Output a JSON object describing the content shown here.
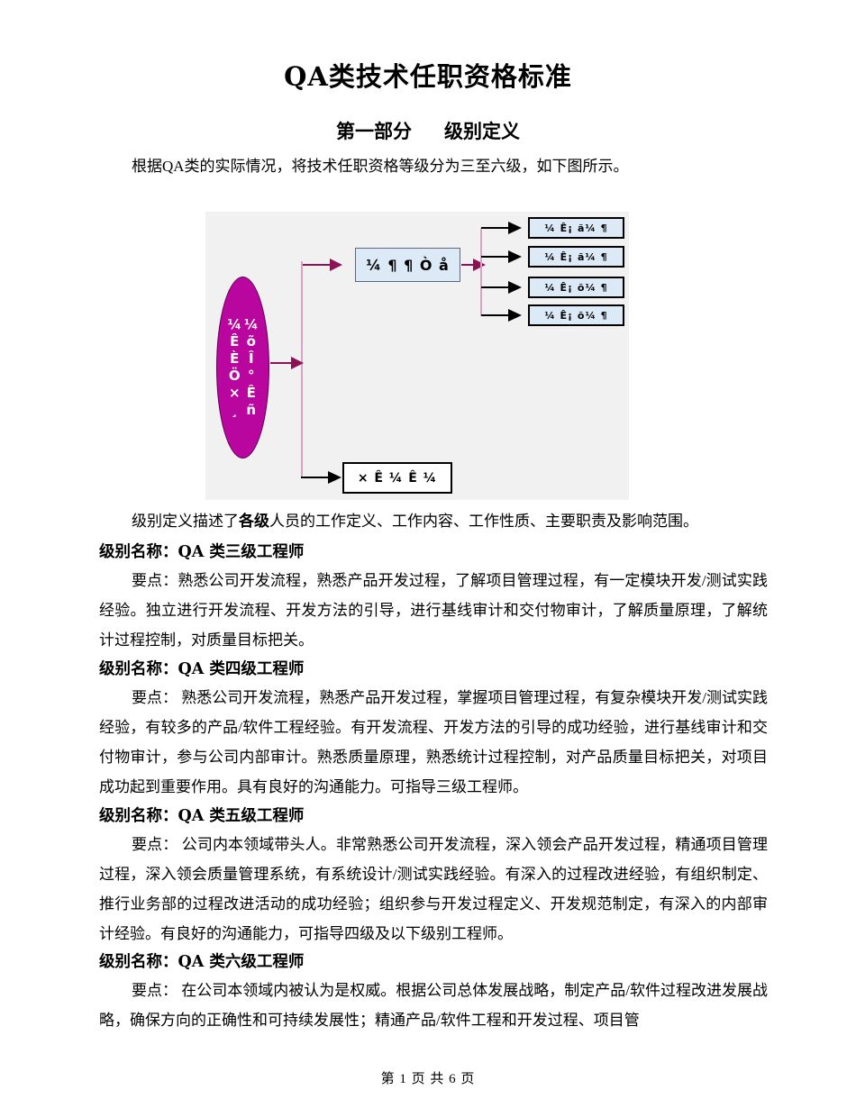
{
  "document": {
    "title": "QA类技术任职资格标准",
    "section_heading_left": "第一部分",
    "section_heading_right": "级别定义",
    "intro": "根据QA类的实际情况，将技术任职资格等级分为三至六级，如下图所示。"
  },
  "figure": {
    "ellipse_col_left": [
      "¼",
      "Ê",
      "È",
      "Ö",
      "×",
      "¸"
    ],
    "ellipse_col_right": [
      "¼",
      "õ",
      "Î",
      "°",
      "Ê",
      "ñ"
    ],
    "center_node": "¼ ¶ ¶ Ò å",
    "bottom_node": "× Ê ¼ Ê ¼",
    "leaf_nodes": [
      "¼ Ê¡ ã¼ ¶",
      "¼ Ê¡ ã¼ ¶",
      "¼ Ê¡ õ¼ ¶",
      "¼ Ê¡ õ¼ ¶"
    ],
    "colors": {
      "background": "#f1f1f1",
      "ellipse_fill": "#b8069e",
      "box_fill": "#dce9f7",
      "connector_pink": "#dca2c4",
      "arrow_pink": "#8c1155",
      "arrow_black": "#000000"
    }
  },
  "body": {
    "summary_line_prefix": "级别定义描述了",
    "summary_line_bold": "各级",
    "summary_line_suffix": "人员的工作定义、工作内容、工作性质、主要职责及影响范围。",
    "levels": [
      {
        "heading": "级别名称：QA 类三级工程师",
        "text": "要点：熟悉公司开发流程，熟悉产品开发过程，了解项目管理过程，有一定模块开发/测试实践经验。独立进行开发流程、开发方法的引导，进行基线审计和交付物审计，了解质量原理，了解统计过程控制，对质量目标把关。"
      },
      {
        "heading": "级别名称：QA 类四级工程师",
        "text": "要点： 熟悉公司开发流程，熟悉产品开发过程，掌握项目管理过程，有复杂模块开发/测试实践经验，有较多的产品/软件工程经验。有开发流程、开发方法的引导的成功经验，进行基线审计和交付物审计，参与公司内部审计。熟悉质量原理，熟悉统计过程控制，对产品质量目标把关，对项目成功起到重要作用。具有良好的沟通能力。可指导三级工程师。"
      },
      {
        "heading": "级别名称：QA 类五级工程师",
        "text": "要点： 公司内本领域带头人。非常熟悉公司开发流程，深入领会产品开发过程，精通项目管理过程，深入领会质量管理系统，有系统设计/测试实践经验。有深入的过程改进经验，有组织制定、推行业务部的过程改进活动的成功经验；组织参与开发过程定义、开发规范制定，有深入的内部审计经验。有良好的沟通能力，可指导四级及以下级别工程师。"
      },
      {
        "heading": "级别名称：QA 类六级工程师",
        "text": "要点： 在公司本领域内被认为是权威。根据公司总体发展战略，制定产品/软件过程改进发展战略，确保方向的正确性和可持续发展性；精通产品/软件工程和开发过程、项目管"
      }
    ]
  },
  "footer": {
    "text": "第 1 页 共 6 页"
  }
}
